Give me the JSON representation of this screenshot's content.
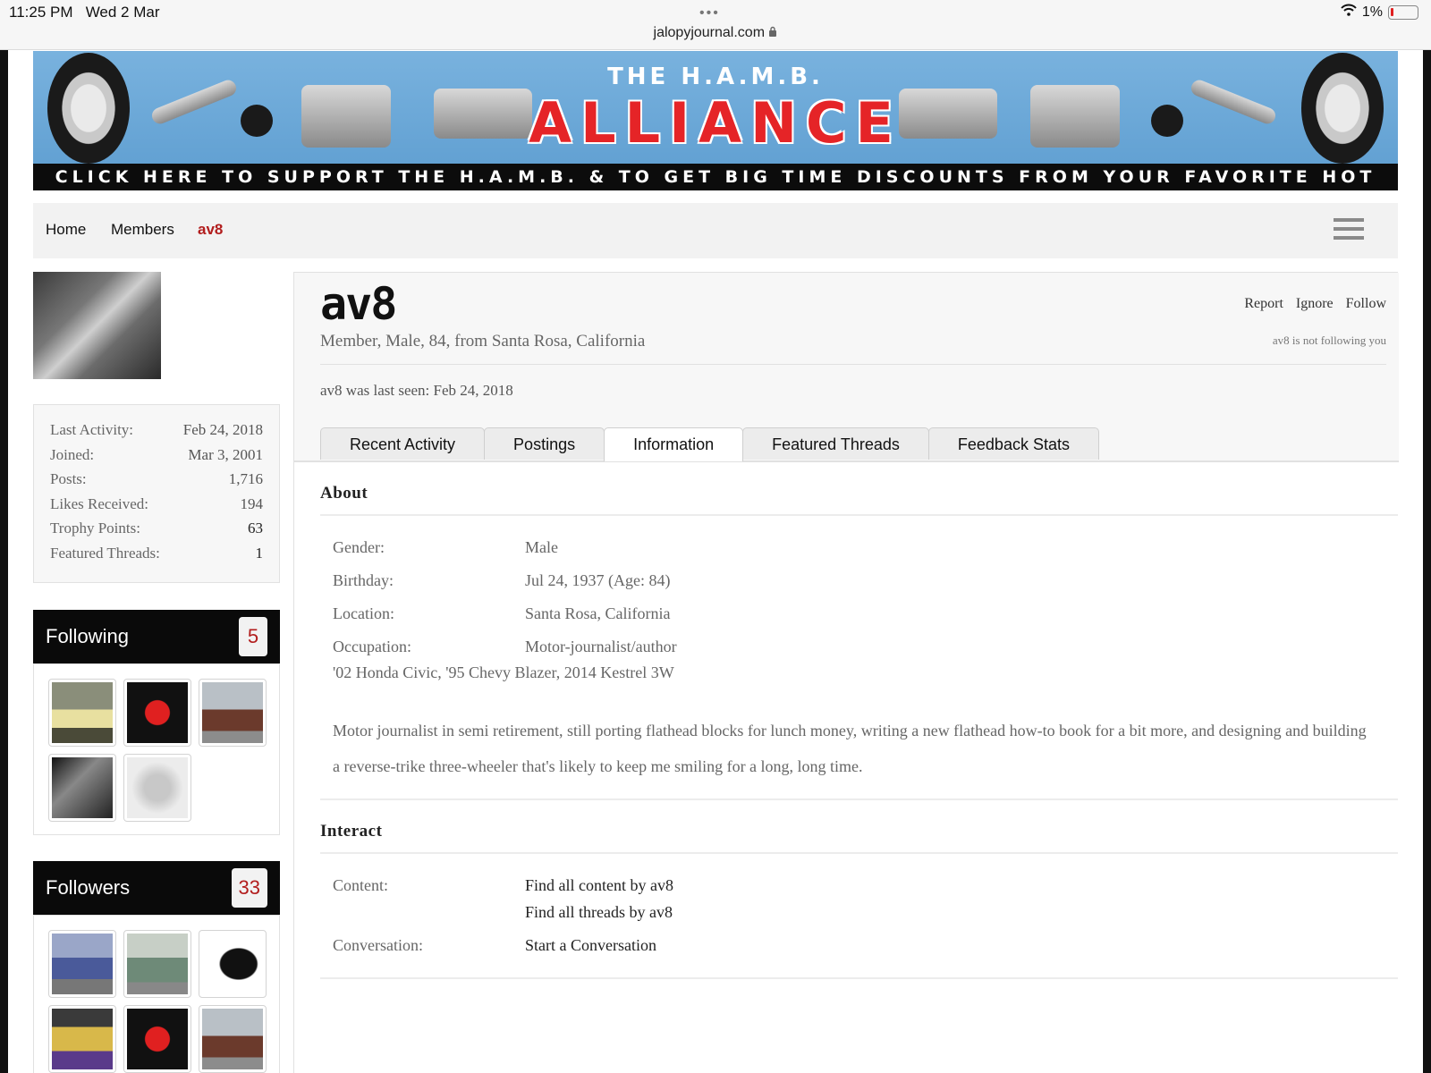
{
  "status_bar": {
    "time": "11:25 PM",
    "date": "Wed 2 Mar",
    "url": "jalopyjournal.com",
    "battery": "1%"
  },
  "banner": {
    "subtitle": "THE H.A.M.B.",
    "title": "ALLIANCE",
    "tagline": "CLICK HERE TO SUPPORT THE H.A.M.B. & TO GET BIG TIME DISCOUNTS FROM YOUR FAVORITE HOT ROD VENDORS!"
  },
  "nav": {
    "items": [
      {
        "label": "Home"
      },
      {
        "label": "Members"
      },
      {
        "label": "av8"
      }
    ]
  },
  "sidebar": {
    "stats": [
      {
        "label": "Last Activity:",
        "value": "Feb 24, 2018"
      },
      {
        "label": "Joined:",
        "value": "Mar 3, 2001"
      },
      {
        "label": "Posts:",
        "value": "1,716"
      },
      {
        "label": "Likes Received:",
        "value": "194"
      },
      {
        "label": "Trophy Points:",
        "value": "63"
      },
      {
        "label": "Featured Threads:",
        "value": "1"
      }
    ],
    "following": {
      "title": "Following",
      "count": "5"
    },
    "followers": {
      "title": "Followers",
      "count": "33"
    }
  },
  "profile": {
    "username": "av8",
    "blurb": "Member, Male, 84, from Santa Rosa, California",
    "actions": [
      "Report",
      "Ignore",
      "Follow"
    ],
    "follow_status": "av8 is not following you",
    "last_seen": "av8 was last seen: Feb 24, 2018",
    "tabs": [
      {
        "label": "Recent Activity"
      },
      {
        "label": "Postings"
      },
      {
        "label": "Information"
      },
      {
        "label": "Featured Threads"
      },
      {
        "label": "Feedback Stats"
      }
    ],
    "active_tab": "Information"
  },
  "about": {
    "title": "About",
    "rows": [
      {
        "label": "Gender:",
        "value": "Male"
      },
      {
        "label": "Birthday:",
        "value": "Jul 24, 1937 (Age: 84)"
      },
      {
        "label": "Location:",
        "value": "Santa Rosa, California"
      },
      {
        "label": "Occupation:",
        "value": "Motor-journalist/author"
      }
    ],
    "vehicles": "'02 Honda Civic, '95 Chevy Blazer, 2014 Kestrel 3W",
    "bio": "Motor journalist in semi retirement, still porting flathead blocks for lunch money, writing a new flathead how-to book for a bit more, and designing and building a reverse-trike three-wheeler that's likely to keep me smiling for a long, long time."
  },
  "interact": {
    "title": "Interact",
    "content_label": "Content:",
    "content_links": [
      "Find all content by av8",
      "Find all threads by av8"
    ],
    "conversation_label": "Conversation:",
    "conversation_link": "Start a Conversation"
  }
}
